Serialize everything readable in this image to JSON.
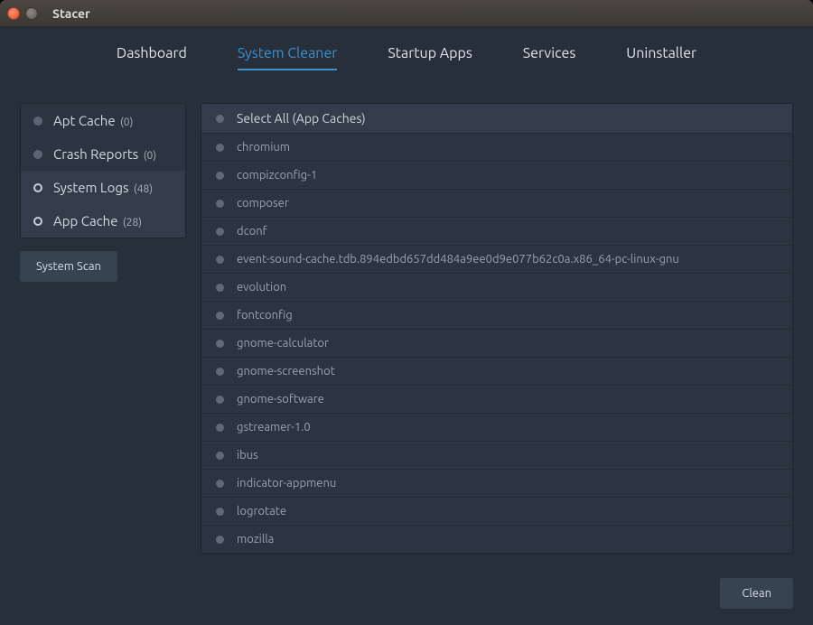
{
  "window": {
    "title": "Stacer"
  },
  "nav": {
    "items": [
      {
        "label": "Dashboard",
        "active": false
      },
      {
        "label": "System Cleaner",
        "active": true
      },
      {
        "label": "Startup Apps",
        "active": false
      },
      {
        "label": "Services",
        "active": false
      },
      {
        "label": "Uninstaller",
        "active": false
      }
    ]
  },
  "sidebar": {
    "items": [
      {
        "label": "Apt Cache",
        "count": "(0)",
        "selected": false
      },
      {
        "label": "Crash Reports",
        "count": "(0)",
        "selected": false
      },
      {
        "label": "System Logs",
        "count": "(48)",
        "selected": true
      },
      {
        "label": "App Cache",
        "count": "(28)",
        "selected": true
      }
    ],
    "scan_label": "System Scan"
  },
  "list": {
    "select_all_label": "Select All (App Caches)",
    "items": [
      "chromium",
      "compizconfig-1",
      "composer",
      "dconf",
      "event-sound-cache.tdb.894edbd657dd484a9ee0d9e077b62c0a.x86_64-pc-linux-gnu",
      "evolution",
      "fontconfig",
      "gnome-calculator",
      "gnome-screenshot",
      "gnome-software",
      "gstreamer-1.0",
      "ibus",
      "indicator-appmenu",
      "logrotate",
      "mozilla"
    ]
  },
  "footer": {
    "clean_label": "Clean"
  }
}
